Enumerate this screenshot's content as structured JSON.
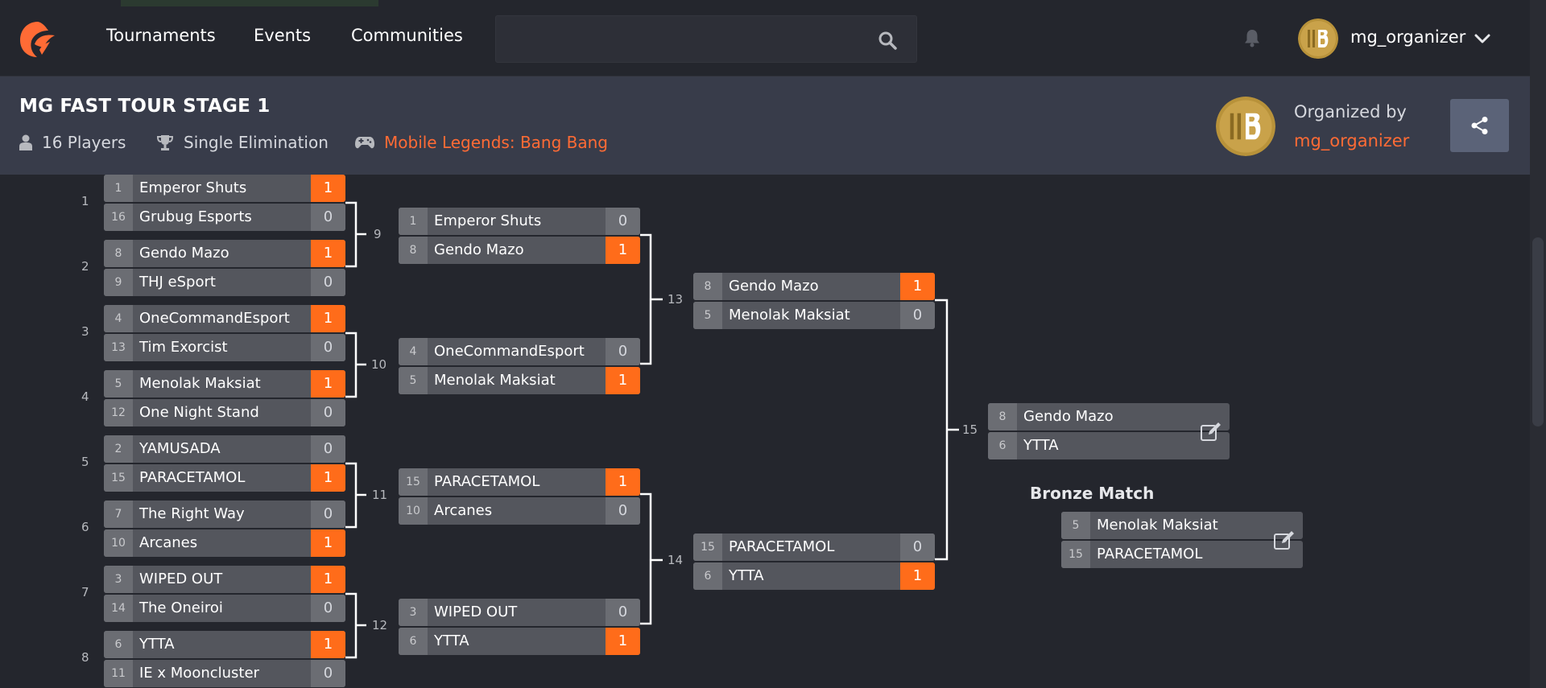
{
  "nav": {
    "links": [
      "Tournaments",
      "Events",
      "Communities"
    ],
    "search_placeholder": "",
    "username": "mg_organizer"
  },
  "tournament": {
    "title": "MG FAST TOUR STAGE 1",
    "players": "16 Players",
    "format": "Single Elimination",
    "game": "Mobile Legends: Bang Bang",
    "organized_by_label": "Organized by",
    "organizer": "mg_organizer"
  },
  "colors": {
    "accent": "#ff6c1a",
    "header_bg": "#383c4a",
    "page_bg": "#24262d",
    "share_btn": "#5b6378"
  },
  "bracket": {
    "round1": [
      {
        "num": "1",
        "p": [
          {
            "seed": "1",
            "name": "Emperor Shuts",
            "score": "1",
            "win": true
          },
          {
            "seed": "16",
            "name": "Grubug Esports",
            "score": "0",
            "win": false
          }
        ]
      },
      {
        "num": "2",
        "p": [
          {
            "seed": "8",
            "name": "Gendo Mazo",
            "score": "1",
            "win": true
          },
          {
            "seed": "9",
            "name": "THJ eSport",
            "score": "0",
            "win": false
          }
        ]
      },
      {
        "num": "3",
        "p": [
          {
            "seed": "4",
            "name": "OneCommandEsport",
            "score": "1",
            "win": true
          },
          {
            "seed": "13",
            "name": "Tim Exorcist",
            "score": "0",
            "win": false
          }
        ]
      },
      {
        "num": "4",
        "p": [
          {
            "seed": "5",
            "name": "Menolak Maksiat",
            "score": "1",
            "win": true
          },
          {
            "seed": "12",
            "name": "One Night Stand",
            "score": "0",
            "win": false
          }
        ]
      },
      {
        "num": "5",
        "p": [
          {
            "seed": "2",
            "name": "YAMUSADA",
            "score": "0",
            "win": false
          },
          {
            "seed": "15",
            "name": "PARACETAMOL",
            "score": "1",
            "win": true
          }
        ]
      },
      {
        "num": "6",
        "p": [
          {
            "seed": "7",
            "name": "The Right Way",
            "score": "0",
            "win": false
          },
          {
            "seed": "10",
            "name": "Arcanes",
            "score": "1",
            "win": true
          }
        ]
      },
      {
        "num": "7",
        "p": [
          {
            "seed": "3",
            "name": "WIPED OUT",
            "score": "1",
            "win": true
          },
          {
            "seed": "14",
            "name": "The Oneiroi",
            "score": "0",
            "win": false
          }
        ]
      },
      {
        "num": "8",
        "p": [
          {
            "seed": "6",
            "name": "YTTA",
            "score": "1",
            "win": true
          },
          {
            "seed": "11",
            "name": "IE x Mooncluster",
            "score": "0",
            "win": false
          }
        ]
      }
    ],
    "round2": [
      {
        "num": "9",
        "p": [
          {
            "seed": "1",
            "name": "Emperor Shuts",
            "score": "0",
            "win": false
          },
          {
            "seed": "8",
            "name": "Gendo Mazo",
            "score": "1",
            "win": true
          }
        ]
      },
      {
        "num": "10",
        "p": [
          {
            "seed": "4",
            "name": "OneCommandEsport",
            "score": "0",
            "win": false
          },
          {
            "seed": "5",
            "name": "Menolak Maksiat",
            "score": "1",
            "win": true
          }
        ]
      },
      {
        "num": "11",
        "p": [
          {
            "seed": "15",
            "name": "PARACETAMOL",
            "score": "1",
            "win": true
          },
          {
            "seed": "10",
            "name": "Arcanes",
            "score": "0",
            "win": false
          }
        ]
      },
      {
        "num": "12",
        "p": [
          {
            "seed": "3",
            "name": "WIPED OUT",
            "score": "0",
            "win": false
          },
          {
            "seed": "6",
            "name": "YTTA",
            "score": "1",
            "win": true
          }
        ]
      }
    ],
    "round3": [
      {
        "num": "13",
        "p": [
          {
            "seed": "8",
            "name": "Gendo Mazo",
            "score": "1",
            "win": true
          },
          {
            "seed": "5",
            "name": "Menolak Maksiat",
            "score": "0",
            "win": false
          }
        ]
      },
      {
        "num": "14",
        "p": [
          {
            "seed": "15",
            "name": "PARACETAMOL",
            "score": "0",
            "win": false
          },
          {
            "seed": "6",
            "name": "YTTA",
            "score": "1",
            "win": true
          }
        ]
      }
    ],
    "final": {
      "num": "15",
      "p": [
        {
          "seed": "8",
          "name": "Gendo Mazo"
        },
        {
          "seed": "6",
          "name": "YTTA"
        }
      ]
    },
    "bronze_title": "Bronze Match",
    "bronze": {
      "p": [
        {
          "seed": "5",
          "name": "Menolak Maksiat"
        },
        {
          "seed": "15",
          "name": "PARACETAMOL"
        }
      ]
    }
  }
}
